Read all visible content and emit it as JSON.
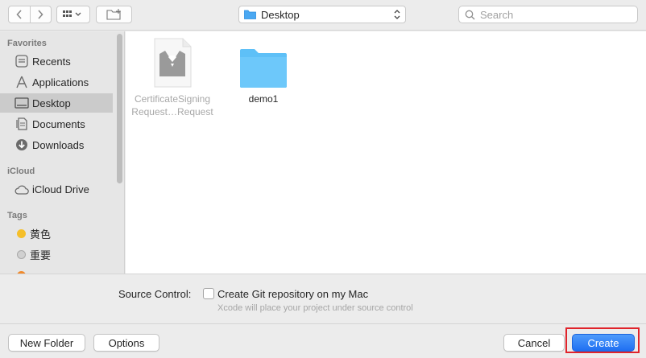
{
  "toolbar": {
    "back_icon": "chevron-left-icon",
    "forward_icon": "chevron-right-icon",
    "view_icon": "grid-view-icon",
    "new_folder_icon": "new-folder-icon",
    "location": "Desktop",
    "search_placeholder": "Search"
  },
  "sidebar": {
    "favorites_title": "Favorites",
    "favorites": [
      {
        "label": "Recents",
        "icon": "clock-icon"
      },
      {
        "label": "Applications",
        "icon": "applications-icon"
      },
      {
        "label": "Desktop",
        "icon": "desktop-icon",
        "selected": true
      },
      {
        "label": "Documents",
        "icon": "document-icon"
      },
      {
        "label": "Downloads",
        "icon": "download-icon"
      }
    ],
    "icloud_title": "iCloud",
    "icloud": [
      {
        "label": "iCloud Drive",
        "icon": "cloud-icon"
      }
    ],
    "tags_title": "Tags",
    "tags": [
      {
        "label": "黄色",
        "color": "#f5bf2a"
      },
      {
        "label": "重要",
        "color": "#c8c8c8"
      }
    ]
  },
  "files": [
    {
      "name_line1": "CertificateSigning",
      "name_line2": "Request…Request",
      "icon": "certificate-request-file-icon",
      "dimmed": true
    },
    {
      "name_line1": "demo1",
      "name_line2": "",
      "icon": "folder-icon",
      "dimmed": false
    }
  ],
  "options": {
    "source_control_label": "Source Control:",
    "checkbox_label": "Create Git repository on my Mac",
    "checkbox_checked": false,
    "hint": "Xcode will place your project under source control"
  },
  "buttons": {
    "new_folder": "New Folder",
    "options": "Options",
    "cancel": "Cancel",
    "create": "Create"
  },
  "colors": {
    "accent": "#1f6ff2",
    "highlight_box": "#e0242b",
    "folder": "#5ec0f7"
  }
}
